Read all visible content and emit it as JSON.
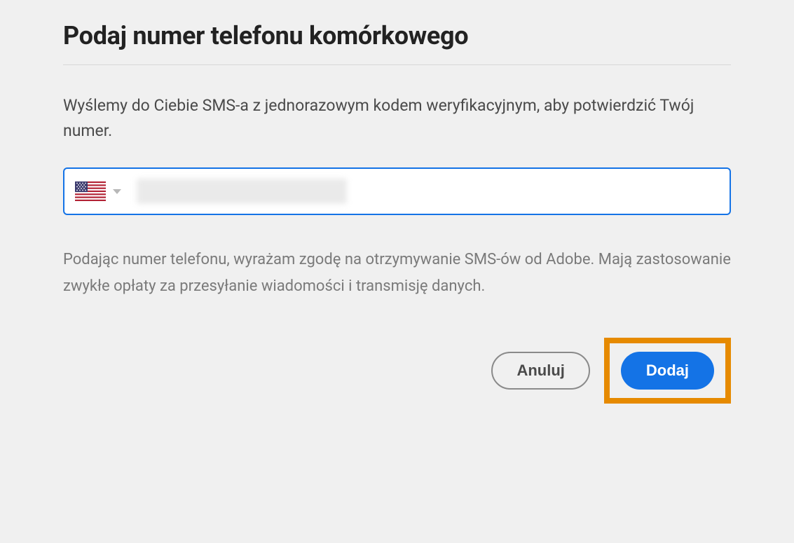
{
  "dialog": {
    "title": "Podaj numer telefonu komórkowego",
    "description": "Wyślemy do Ciebie SMS-a z jednorazowym kodem weryfikacyjnym, aby potwierdzić Twój numer.",
    "consent": "Podając numer telefonu, wyrażam zgodę na otrzymywanie SMS-ów od Adobe. Mają zastosowanie zwykłe opłaty za przesyłanie wiadomości i transmisję danych.",
    "phone_country": "us",
    "phone_value": "",
    "buttons": {
      "cancel": "Anuluj",
      "add": "Dodaj"
    }
  },
  "colors": {
    "primary": "#1473e6",
    "highlight": "#e68a00"
  }
}
